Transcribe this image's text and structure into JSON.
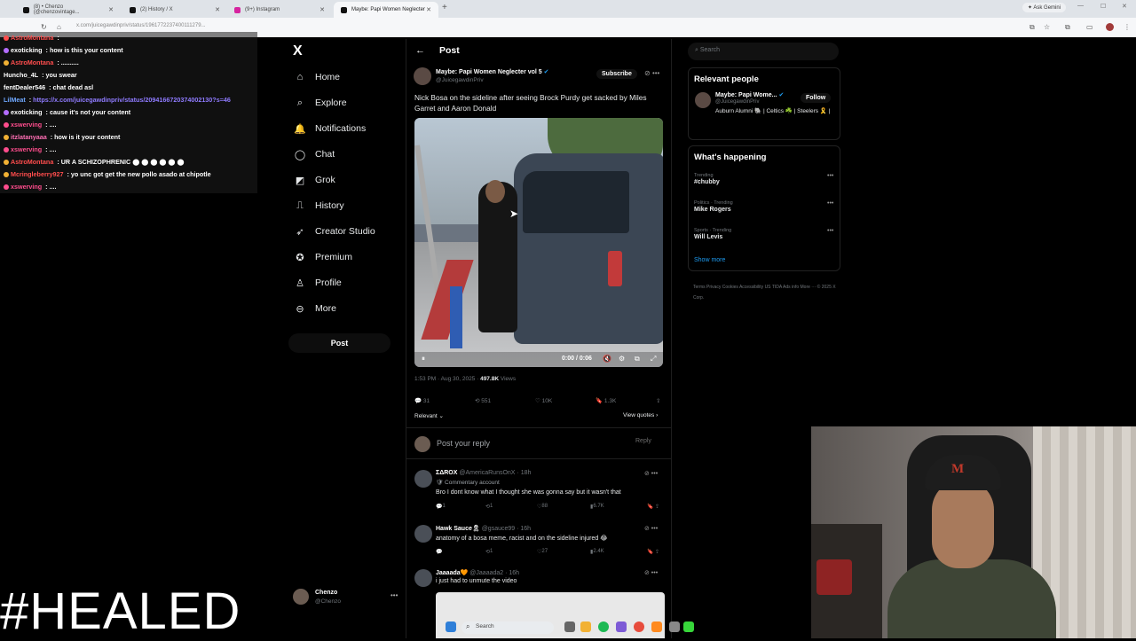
{
  "browser": {
    "tabs": [
      {
        "label": "(8) • Chenzo (@chenzovintage...",
        "color": "#111111"
      },
      {
        "label": "(2) History / X",
        "color": "#111111"
      },
      {
        "label": "(9+) Instagram",
        "color": "#d6249f"
      },
      {
        "label": "Maybe: Papi Women Neglecter",
        "color": "#111111"
      }
    ],
    "url": "x.com/juicegawdinpriv/status/1961772237400111279...",
    "ask_gemini": "Ask Gemini"
  },
  "chat": [
    {
      "user": "AstroMontana",
      "sep": " :",
      "text": "",
      "color": "#ff4d4d",
      "badge": "#ff4d4d"
    },
    {
      "user": "exoticking",
      "sep": " :",
      "text": " how is this your content",
      "color": "#ffffff",
      "badge": "#b46cff"
    },
    {
      "user": "AstroMontana",
      "sep": " :",
      "text": " ..........",
      "color": "#ff4d4d",
      "badge": "#f2b134"
    },
    {
      "user": "Huncho_4L",
      "sep": " :",
      "text": " you swear",
      "color": "#ffffff",
      "badge": ""
    },
    {
      "user": "fentDealer546",
      "sep": " :",
      "text": " chat dead asl",
      "color": "#ffffff",
      "badge": ""
    },
    {
      "user": "LilMeat",
      "sep": " :",
      "text": " https://x.com/juicegawdinpriv/status/2094166720374002130?s=46",
      "color": "#6fa8ff",
      "badge": "",
      "text_color": "#8f7bff"
    },
    {
      "user": "exoticking",
      "sep": " :",
      "text": " cause it's not your content",
      "color": "#ffffff",
      "badge": "#b46cff"
    },
    {
      "user": "xswerving",
      "sep": " :",
      "text": " ....",
      "color": "#ff4d8d",
      "badge": "#ff4d8d"
    },
    {
      "user": "itzlatanyaaa",
      "sep": " :",
      "text": " how is it your content",
      "color": "#ff6fb4",
      "badge": "#f2b134"
    },
    {
      "user": "xswerving",
      "sep": " :",
      "text": " ....",
      "color": "#ff4d8d",
      "badge": "#ff4d8d"
    },
    {
      "user": "AstroMontana",
      "sep": " :",
      "text": " UR A SCHIZOPHRENIC ⬤ ⬤ ⬤ ⬤ ⬤ ⬤",
      "color": "#ff4d4d",
      "badge": "#f2b134"
    },
    {
      "user": "Mcringleberry927",
      "sep": " :",
      "text": " yo unc got get the new pollo asado at chipotle",
      "color": "#ff4d4d",
      "badge": "#f2b134"
    },
    {
      "user": "xswerving",
      "sep": " :",
      "text": " ....",
      "color": "#ff4d8d",
      "badge": "#ff4d8d"
    }
  ],
  "nav": {
    "logo": "X",
    "items": [
      {
        "label": "Home",
        "icon": "⌂"
      },
      {
        "label": "Explore",
        "icon": "⌕"
      },
      {
        "label": "Notifications",
        "icon": "🔔"
      },
      {
        "label": "Chat",
        "icon": "◯"
      },
      {
        "label": "Grok",
        "icon": "◩"
      },
      {
        "label": "History",
        "icon": "⎍"
      },
      {
        "label": "Creator Studio",
        "icon": "➶"
      },
      {
        "label": "Premium",
        "icon": "✪"
      },
      {
        "label": "Profile",
        "icon": "♙"
      },
      {
        "label": "More",
        "icon": "⊖"
      }
    ],
    "post_button": "Post",
    "account": {
      "name": "Chenzo",
      "handle": "@Chenzo"
    }
  },
  "post": {
    "header": "Post",
    "author_name": "Maybe: Papi Women Neglecter vol 5",
    "author_handle": "@JuicegawdinPriv",
    "subscribe": "Subscribe",
    "text": "Nick Bosa on the sideline after seeing Brock Purdy get sacked by Miles Garret and Aaron Donald",
    "video_time": "0:00 / 0:06",
    "timestamp": "1:53 PM · Aug 30, 2025 · ",
    "views_count": "497.8K",
    "views_label": " Views",
    "replies": "31",
    "reposts": "551",
    "likes": "10K",
    "bookmarks": "1.3K",
    "relevant": "Relevant ⌄",
    "view_quotes": "View quotes ›",
    "reply_placeholder": "Post your reply",
    "reply_button": "Reply"
  },
  "replies": [
    {
      "name": "ΣΔROX",
      "handle": " @AmericaRunsOnX · 18h",
      "sub": "🛡 Commentary account",
      "text": "Bro I dont know what I thought she was gonna say but it wasn't that",
      "replies": "1",
      "reposts": "1",
      "likes": "88",
      "views": "6.7K"
    },
    {
      "name": "Hawk Sauce🎗",
      "handle": " @gsauce99 · 16h",
      "sub": "",
      "text": "anatomy of a bosa meme, racist and on the sideline injured 😂",
      "replies": "",
      "reposts": "1",
      "likes": "27",
      "views": "2.4K"
    },
    {
      "name": "Jaaaada🧡",
      "handle": " @Jaaaada2 · 16h",
      "sub": "",
      "text": "i just had to unmute the video",
      "replies": "",
      "reposts": "",
      "likes": "",
      "views": ""
    }
  ],
  "right": {
    "search_placeholder": "Search",
    "relevant_title": "Relevant people",
    "person_name": "Maybe: Papi Wome...",
    "person_handle": "@JuicegawdinPriv",
    "person_bio": "Auburn Alumni 🐘 | Celtics ☘️ | Steelers 🎗️ | ",
    "follow": "Follow",
    "happening_title": "What's happening",
    "trends": [
      {
        "category": "Trending",
        "topic": "#chubby"
      },
      {
        "category": "Politics · Trending",
        "topic": "Mike Rogers"
      },
      {
        "category": "Sports · Trending",
        "topic": "Will Levis"
      }
    ],
    "show_more": "Show more",
    "footer": "Terms   Privacy   Cookies   Accessibility   US TIDA   Ads info   More ···   © 2025 X Corp."
  },
  "overlay": {
    "healed": "#HEALED"
  },
  "taskbar": {
    "search": "Search"
  }
}
